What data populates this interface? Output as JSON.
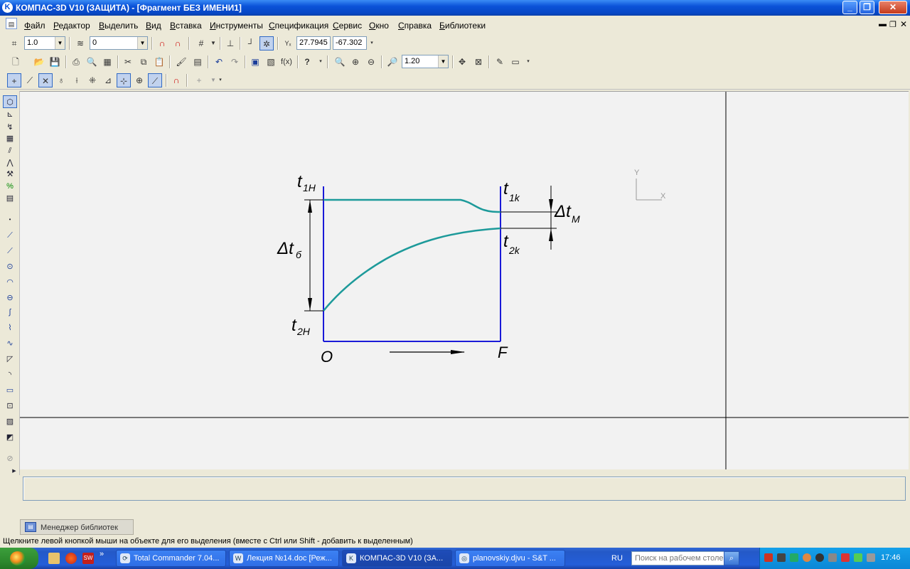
{
  "window": {
    "title": "КОМПАС-3D V10 (ЗАЩИТА) - [Фрагмент БЕЗ ИМЕНИ1]",
    "app_icon": "K"
  },
  "menu": {
    "items": [
      "Файл",
      "Редактор",
      "Выделить",
      "Вид",
      "Вставка",
      "Инструменты",
      "Спецификация",
      "Сервис",
      "Окно",
      "Справка",
      "Библиотеки"
    ]
  },
  "toolbar1": {
    "step_value": "1.0",
    "layer_value": "0",
    "coord_x": "27.7945",
    "coord_y": "-67.302"
  },
  "toolbar2": {
    "zoom_value": "1.20"
  },
  "drawing": {
    "label_t1h": "t",
    "label_t1h_sub": "1H",
    "label_t2h": "t",
    "label_t2h_sub": "2H",
    "label_t1k": "t",
    "label_t1k_sub": "1k",
    "label_t2k": "t",
    "label_t2k_sub": "2k",
    "label_dtb": "Δt",
    "label_dtb_sub": "б",
    "label_dtm": "Δt",
    "label_dtm_sub": "M",
    "label_o": "O",
    "label_f": "F",
    "axis_y": "Y",
    "axis_x": "X",
    "colors": {
      "frame": "#1a1ad8",
      "curve": "#1d9a9a",
      "dim": "#000000"
    }
  },
  "panel": {
    "library_tab": "Менеджер библиотек"
  },
  "status": {
    "text": "Щелкните левой кнопкой мыши на объекте для его выделения (вместе с Ctrl или Shift - добавить к выделенным)"
  },
  "taskbar": {
    "tasks": [
      {
        "label": "Total Commander 7.04...",
        "icon": "total-commander-icon"
      },
      {
        "label": "Лекция №14.doc [Реж...",
        "icon": "word-icon"
      },
      {
        "label": "КОМПАС-3D V10 (ЗА...",
        "icon": "kompas-icon"
      },
      {
        "label": "planovskiy.djvu - S&T ...",
        "icon": "djvu-icon"
      }
    ],
    "language": "RU",
    "search_placeholder": "Поиск на рабочем столе",
    "clock": "17:46"
  }
}
